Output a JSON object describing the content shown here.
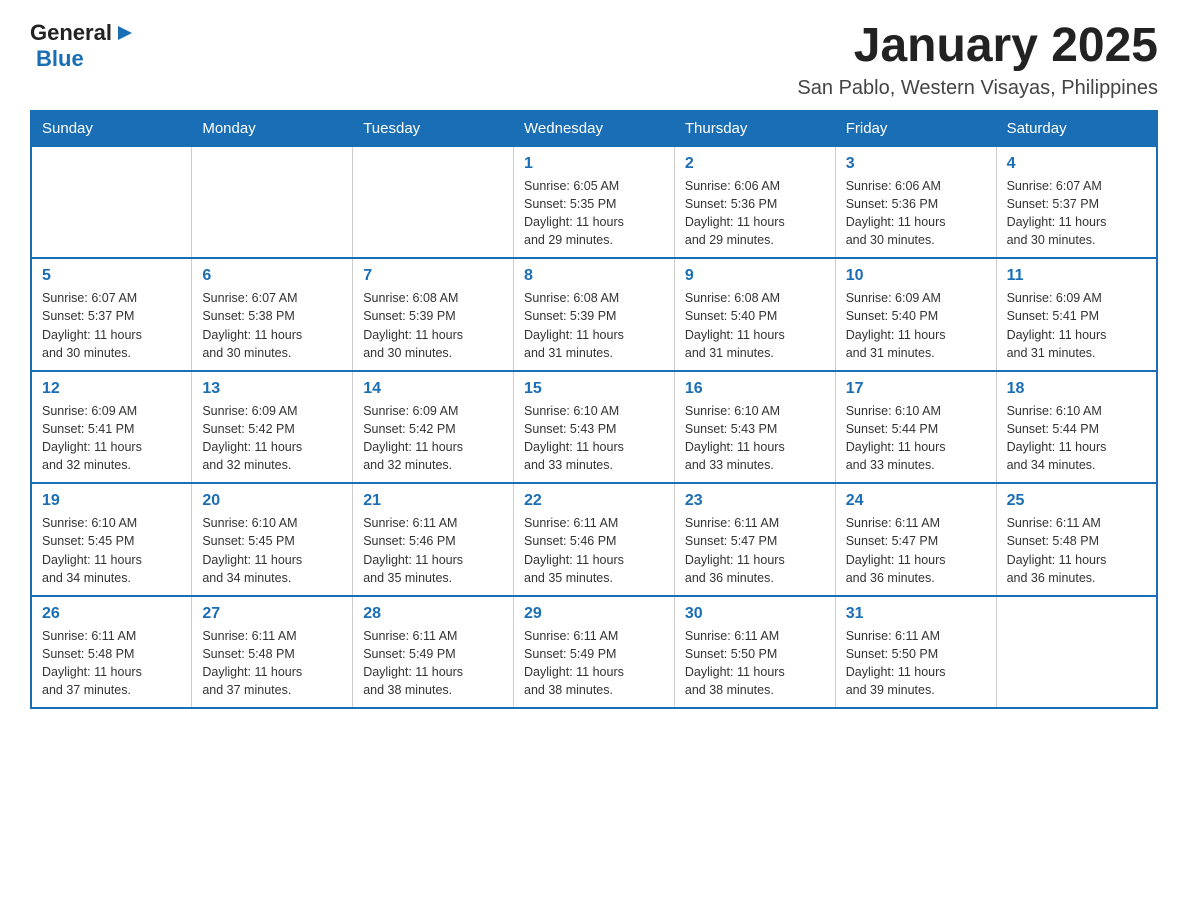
{
  "header": {
    "logo": {
      "general": "General",
      "blue": "Blue"
    },
    "title": "January 2025",
    "location": "San Pablo, Western Visayas, Philippines"
  },
  "calendar": {
    "days_of_week": [
      "Sunday",
      "Monday",
      "Tuesday",
      "Wednesday",
      "Thursday",
      "Friday",
      "Saturday"
    ],
    "weeks": [
      {
        "cells": [
          {
            "day": "",
            "info": ""
          },
          {
            "day": "",
            "info": ""
          },
          {
            "day": "",
            "info": ""
          },
          {
            "day": "1",
            "info": "Sunrise: 6:05 AM\nSunset: 5:35 PM\nDaylight: 11 hours\nand 29 minutes."
          },
          {
            "day": "2",
            "info": "Sunrise: 6:06 AM\nSunset: 5:36 PM\nDaylight: 11 hours\nand 29 minutes."
          },
          {
            "day": "3",
            "info": "Sunrise: 6:06 AM\nSunset: 5:36 PM\nDaylight: 11 hours\nand 30 minutes."
          },
          {
            "day": "4",
            "info": "Sunrise: 6:07 AM\nSunset: 5:37 PM\nDaylight: 11 hours\nand 30 minutes."
          }
        ]
      },
      {
        "cells": [
          {
            "day": "5",
            "info": "Sunrise: 6:07 AM\nSunset: 5:37 PM\nDaylight: 11 hours\nand 30 minutes."
          },
          {
            "day": "6",
            "info": "Sunrise: 6:07 AM\nSunset: 5:38 PM\nDaylight: 11 hours\nand 30 minutes."
          },
          {
            "day": "7",
            "info": "Sunrise: 6:08 AM\nSunset: 5:39 PM\nDaylight: 11 hours\nand 30 minutes."
          },
          {
            "day": "8",
            "info": "Sunrise: 6:08 AM\nSunset: 5:39 PM\nDaylight: 11 hours\nand 31 minutes."
          },
          {
            "day": "9",
            "info": "Sunrise: 6:08 AM\nSunset: 5:40 PM\nDaylight: 11 hours\nand 31 minutes."
          },
          {
            "day": "10",
            "info": "Sunrise: 6:09 AM\nSunset: 5:40 PM\nDaylight: 11 hours\nand 31 minutes."
          },
          {
            "day": "11",
            "info": "Sunrise: 6:09 AM\nSunset: 5:41 PM\nDaylight: 11 hours\nand 31 minutes."
          }
        ]
      },
      {
        "cells": [
          {
            "day": "12",
            "info": "Sunrise: 6:09 AM\nSunset: 5:41 PM\nDaylight: 11 hours\nand 32 minutes."
          },
          {
            "day": "13",
            "info": "Sunrise: 6:09 AM\nSunset: 5:42 PM\nDaylight: 11 hours\nand 32 minutes."
          },
          {
            "day": "14",
            "info": "Sunrise: 6:09 AM\nSunset: 5:42 PM\nDaylight: 11 hours\nand 32 minutes."
          },
          {
            "day": "15",
            "info": "Sunrise: 6:10 AM\nSunset: 5:43 PM\nDaylight: 11 hours\nand 33 minutes."
          },
          {
            "day": "16",
            "info": "Sunrise: 6:10 AM\nSunset: 5:43 PM\nDaylight: 11 hours\nand 33 minutes."
          },
          {
            "day": "17",
            "info": "Sunrise: 6:10 AM\nSunset: 5:44 PM\nDaylight: 11 hours\nand 33 minutes."
          },
          {
            "day": "18",
            "info": "Sunrise: 6:10 AM\nSunset: 5:44 PM\nDaylight: 11 hours\nand 34 minutes."
          }
        ]
      },
      {
        "cells": [
          {
            "day": "19",
            "info": "Sunrise: 6:10 AM\nSunset: 5:45 PM\nDaylight: 11 hours\nand 34 minutes."
          },
          {
            "day": "20",
            "info": "Sunrise: 6:10 AM\nSunset: 5:45 PM\nDaylight: 11 hours\nand 34 minutes."
          },
          {
            "day": "21",
            "info": "Sunrise: 6:11 AM\nSunset: 5:46 PM\nDaylight: 11 hours\nand 35 minutes."
          },
          {
            "day": "22",
            "info": "Sunrise: 6:11 AM\nSunset: 5:46 PM\nDaylight: 11 hours\nand 35 minutes."
          },
          {
            "day": "23",
            "info": "Sunrise: 6:11 AM\nSunset: 5:47 PM\nDaylight: 11 hours\nand 36 minutes."
          },
          {
            "day": "24",
            "info": "Sunrise: 6:11 AM\nSunset: 5:47 PM\nDaylight: 11 hours\nand 36 minutes."
          },
          {
            "day": "25",
            "info": "Sunrise: 6:11 AM\nSunset: 5:48 PM\nDaylight: 11 hours\nand 36 minutes."
          }
        ]
      },
      {
        "cells": [
          {
            "day": "26",
            "info": "Sunrise: 6:11 AM\nSunset: 5:48 PM\nDaylight: 11 hours\nand 37 minutes."
          },
          {
            "day": "27",
            "info": "Sunrise: 6:11 AM\nSunset: 5:48 PM\nDaylight: 11 hours\nand 37 minutes."
          },
          {
            "day": "28",
            "info": "Sunrise: 6:11 AM\nSunset: 5:49 PM\nDaylight: 11 hours\nand 38 minutes."
          },
          {
            "day": "29",
            "info": "Sunrise: 6:11 AM\nSunset: 5:49 PM\nDaylight: 11 hours\nand 38 minutes."
          },
          {
            "day": "30",
            "info": "Sunrise: 6:11 AM\nSunset: 5:50 PM\nDaylight: 11 hours\nand 38 minutes."
          },
          {
            "day": "31",
            "info": "Sunrise: 6:11 AM\nSunset: 5:50 PM\nDaylight: 11 hours\nand 39 minutes."
          },
          {
            "day": "",
            "info": ""
          }
        ]
      }
    ]
  }
}
